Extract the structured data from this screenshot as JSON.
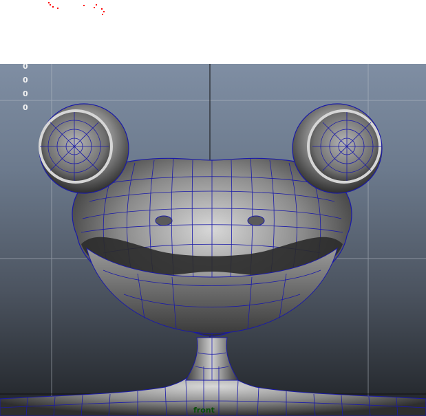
{
  "viewport": {
    "hud_values": [
      "0",
      "0",
      "0",
      "0"
    ],
    "camera_label": "front"
  },
  "colors": {
    "background_top": "#7f8ea3",
    "background_bottom": "#1f2226",
    "wireframe": "#1a1aa8",
    "grid": "#b9c0c8",
    "axis": "#101010",
    "marker": "#ff0000"
  }
}
